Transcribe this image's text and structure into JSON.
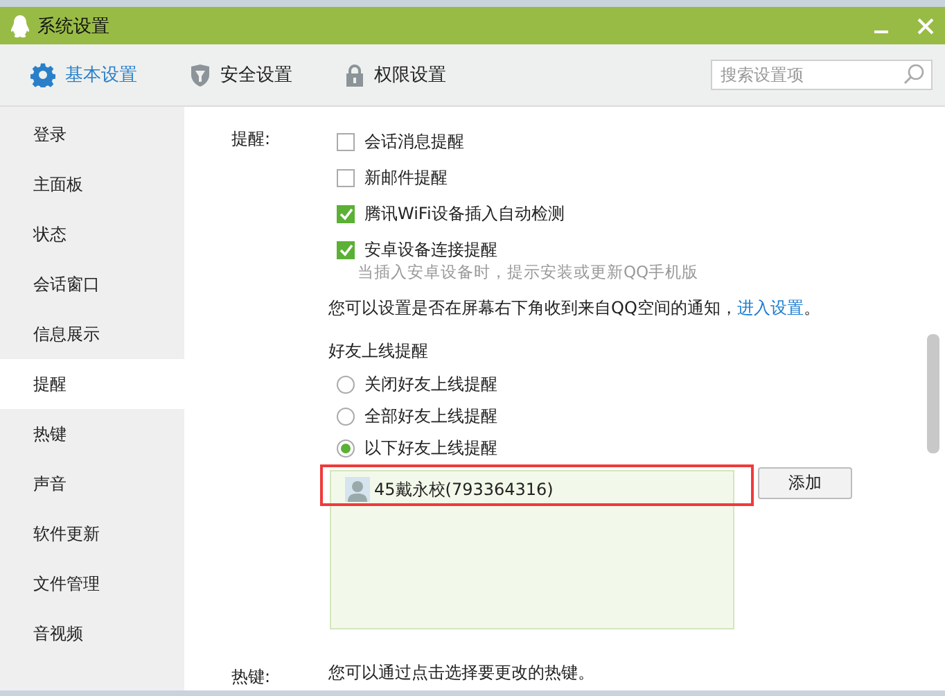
{
  "window": {
    "title": "系统设置"
  },
  "tabs": [
    {
      "label": "基本设置",
      "selected": true,
      "kind": "gear"
    },
    {
      "label": "安全设置",
      "selected": false,
      "kind": "shield"
    },
    {
      "label": "权限设置",
      "selected": false,
      "kind": "lock"
    }
  ],
  "search": {
    "placeholder": "搜索设置项"
  },
  "sidebar": {
    "items": [
      {
        "label": "登录",
        "selected": false
      },
      {
        "label": "主面板",
        "selected": false
      },
      {
        "label": "状态",
        "selected": false
      },
      {
        "label": "会话窗口",
        "selected": false
      },
      {
        "label": "信息展示",
        "selected": false
      },
      {
        "label": "提醒",
        "selected": true
      },
      {
        "label": "热键",
        "selected": false
      },
      {
        "label": "声音",
        "selected": false
      },
      {
        "label": "软件更新",
        "selected": false
      },
      {
        "label": "文件管理",
        "selected": false
      },
      {
        "label": "音视频",
        "selected": false
      }
    ]
  },
  "reminder": {
    "label": "提醒:",
    "checkboxes": [
      {
        "label": "会话消息提醒",
        "checked": false
      },
      {
        "label": "新邮件提醒",
        "checked": false
      },
      {
        "label": "腾讯WiFi设备插入自动检测",
        "checked": true
      },
      {
        "label": "安卓设备连接提醒",
        "checked": true,
        "hint": "当插入安卓设备时，提示安装或更新QQ手机版"
      }
    ],
    "notice": "您可以设置是否在屏幕右下角收到来自QQ空间的通知，",
    "notice_link": "进入设置",
    "notice_end": "。",
    "friend_online": {
      "title": "好友上线提醒",
      "radios": [
        {
          "label": "关闭好友上线提醒",
          "selected": false
        },
        {
          "label": "全部好友上线提醒",
          "selected": false
        },
        {
          "label": "以下好友上线提醒",
          "selected": true
        }
      ],
      "friends": [
        {
          "name": "45戴永校(793364316)"
        }
      ],
      "add_button": "添加"
    }
  },
  "hotkey": {
    "label": "热键:",
    "text": "您可以通过点击选择要更改的热键。"
  }
}
